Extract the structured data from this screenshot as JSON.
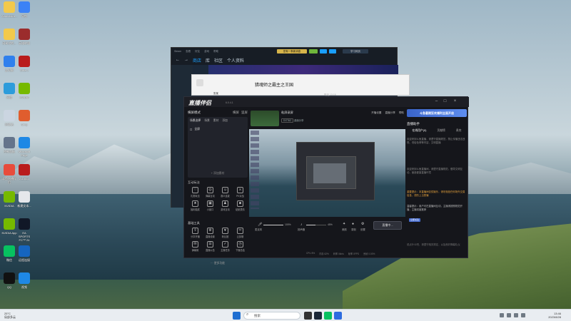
{
  "desktop": {
    "icons": [
      {
        "name": "folder",
        "label": "Administra..."
      },
      {
        "name": "navigate",
        "label": "导航"
      },
      {
        "name": "tripadvisor",
        "label": "网易游戏..."
      },
      {
        "name": "game-red",
        "label": "英雄联盟"
      },
      {
        "name": "display",
        "label": "此电脑"
      },
      {
        "name": "dota",
        "label": "Dota 2"
      },
      {
        "name": "network",
        "label": "网络"
      },
      {
        "name": "nvidia",
        "label": "NVIDIA"
      },
      {
        "name": "recycle",
        "label": "回收站"
      },
      {
        "name": "umbrella",
        "label": "Stmp"
      },
      {
        "name": "control-panel",
        "label": "控制面板"
      },
      {
        "name": "edge-browser",
        "label": "Microsoft Edge"
      },
      {
        "name": "live-assistant",
        "label": "斗鱼直播伴侣"
      },
      {
        "name": "64-app",
        "label": "AIDA64"
      },
      {
        "name": "nvidia-2",
        "label": "NVIDIA"
      },
      {
        "name": "notes",
        "label": "新建文本..."
      },
      {
        "name": "nvidia-app",
        "label": "NVIDIA App"
      },
      {
        "name": "ea-sports",
        "label": "EA SPORTS FC™ 24"
      },
      {
        "name": "wechat",
        "label": "微信"
      },
      {
        "name": "remote",
        "label": "远程连接"
      },
      {
        "name": "qq",
        "label": "QQ"
      },
      {
        "name": "video",
        "label": "视频"
      }
    ]
  },
  "taskbar": {
    "weather_temp": "25°C",
    "weather_desc": "局部多云",
    "search_placeholder": "搜索",
    "time": "13:46",
    "date": "2023/8/28"
  },
  "steam": {
    "title": "Steam",
    "menu": [
      "Steam",
      "查看",
      "好友",
      "游戏",
      "帮助"
    ],
    "nav_store": "商店",
    "nav_library": "库",
    "nav_community": "社区",
    "nav_profile": "个人资料",
    "promo_pill": "您有一条新消息",
    "user_pill": "学习网页"
  },
  "wechat": {
    "chat_title": "猎魂师之霸主之王国",
    "contact": "张某",
    "time_label": "昨天 13:16"
  },
  "live": {
    "app_title": "直播伴侣",
    "version": "6.0.4.1",
    "mode_label": "横屏模式",
    "mode_switch": "横屏",
    "mode_portrait": "竖屏",
    "scene_section": "场景选择",
    "scene_tabs": [
      "场景",
      "素材",
      "添加"
    ],
    "scene_item": "全屏",
    "scene_add": "+ 添加素材",
    "interact_section": "互动玩法",
    "interact_tools": [
      "礼物玩法",
      "弹幕互动",
      "观众连麦",
      "PK对战",
      "福利抽奖",
      "小窗口",
      "游戏互动",
      "贴纸表情"
    ],
    "basic_section": "基础工具",
    "basic_tools": [
      "分享开播",
      "直播设置",
      "粉丝团",
      "云剪辑",
      "弹幕姬",
      "直播公告",
      "主播任务",
      "下播总结"
    ],
    "more_btn": "··· 更多功能",
    "rec_title": "粘屏录屏",
    "rec_game": "DOTA2",
    "rec_type": "桌面分享",
    "rec_tools": [
      "开播设置",
      "直播分享",
      "帮助"
    ],
    "mic_label": "麦克风",
    "mic_pct": "100%",
    "speaker_label": "扬声器",
    "speaker_pct": "45%",
    "mic_level": 1.0,
    "speaker_level": 0.45,
    "ctrl_icons": [
      "美颜",
      "录制",
      "设置"
    ],
    "go_live": "直播中...",
    "status": [
      "CPU 8%",
      "内存 62%",
      "码率 0kb/s",
      "帧率 0FPS",
      "丢帧 0.00%"
    ],
    "promo": "斗鱼暑期狂欢福利全面开启",
    "assist_title": "直播助手",
    "assist_tabs": [
      "在线用户(0)",
      "贡献榜",
      "贵宾"
    ],
    "msg1": "欢迎来到斗鱼直播，请遵守直播规范，禁止传播违法违规、低俗色情等内容，文明直播",
    "msg2": "欢迎来到斗鱼直播间，请遵守直播规范，倡导文明互动，营造健康直播环境",
    "msg3": "重要提示：本直播间仅供娱乐，请勿相信任何场外交易信息，谨防上当受骗",
    "msg4": "温馨提示：用户可在直播间互动，主播请按照规范开播，主播将被推荐",
    "follow_btn": "立即关注",
    "chat_input": "说点什么吧，请遵守相关规定，以及良好弹幕礼仪"
  }
}
